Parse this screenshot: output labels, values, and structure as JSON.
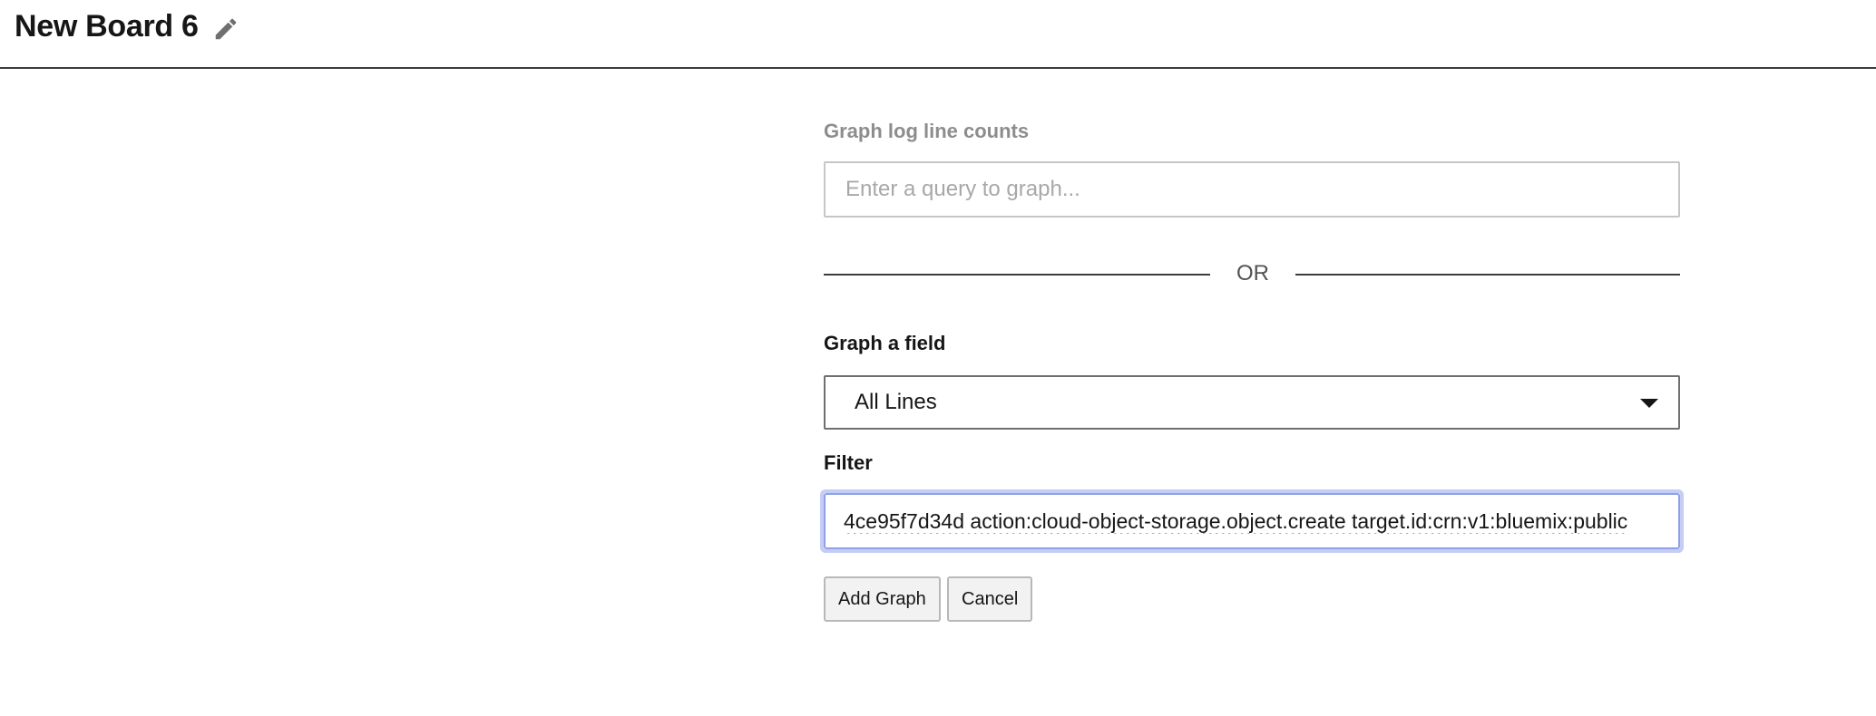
{
  "header": {
    "board_title": "New Board 6",
    "edit_icon": "pencil-icon"
  },
  "graph_form": {
    "log_counts_label": "Graph log line counts",
    "query_placeholder": "Enter a query to graph...",
    "query_value": "",
    "or_text": "OR",
    "field_label": "Graph a field",
    "field_selected": "All Lines",
    "field_caret_icon": "caret-down-icon",
    "filter_label": "Filter",
    "filter_value": "4ce95f7d34d action:cloud-object-storage.object.create target.id:crn:v1:bluemix:public",
    "add_button": "Add Graph",
    "cancel_button": "Cancel"
  },
  "colors": {
    "focus_ring": "#c6cdf5",
    "muted_label": "#8d8d8d",
    "divider": "#3d3d3d"
  }
}
